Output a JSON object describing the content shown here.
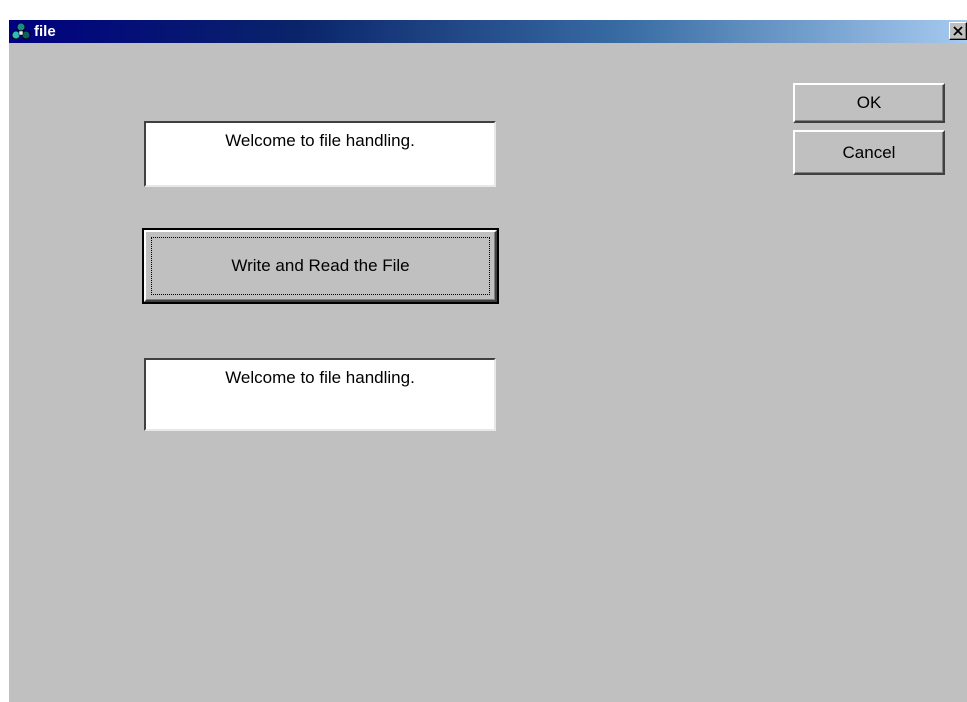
{
  "window": {
    "title": "file",
    "icon": "app-icon",
    "close_label": "close-icon"
  },
  "dialog": {
    "textbox_top_value": "Welcome to file handling.",
    "action_button_label": "Write and Read the File",
    "textbox_bottom_value": "Welcome to file handling.",
    "ok_label": "OK",
    "cancel_label": "Cancel"
  },
  "colors": {
    "titlebar_start": "#000080",
    "titlebar_end": "#a6caf0",
    "face": "#c0c0c0",
    "field": "#ffffff"
  }
}
